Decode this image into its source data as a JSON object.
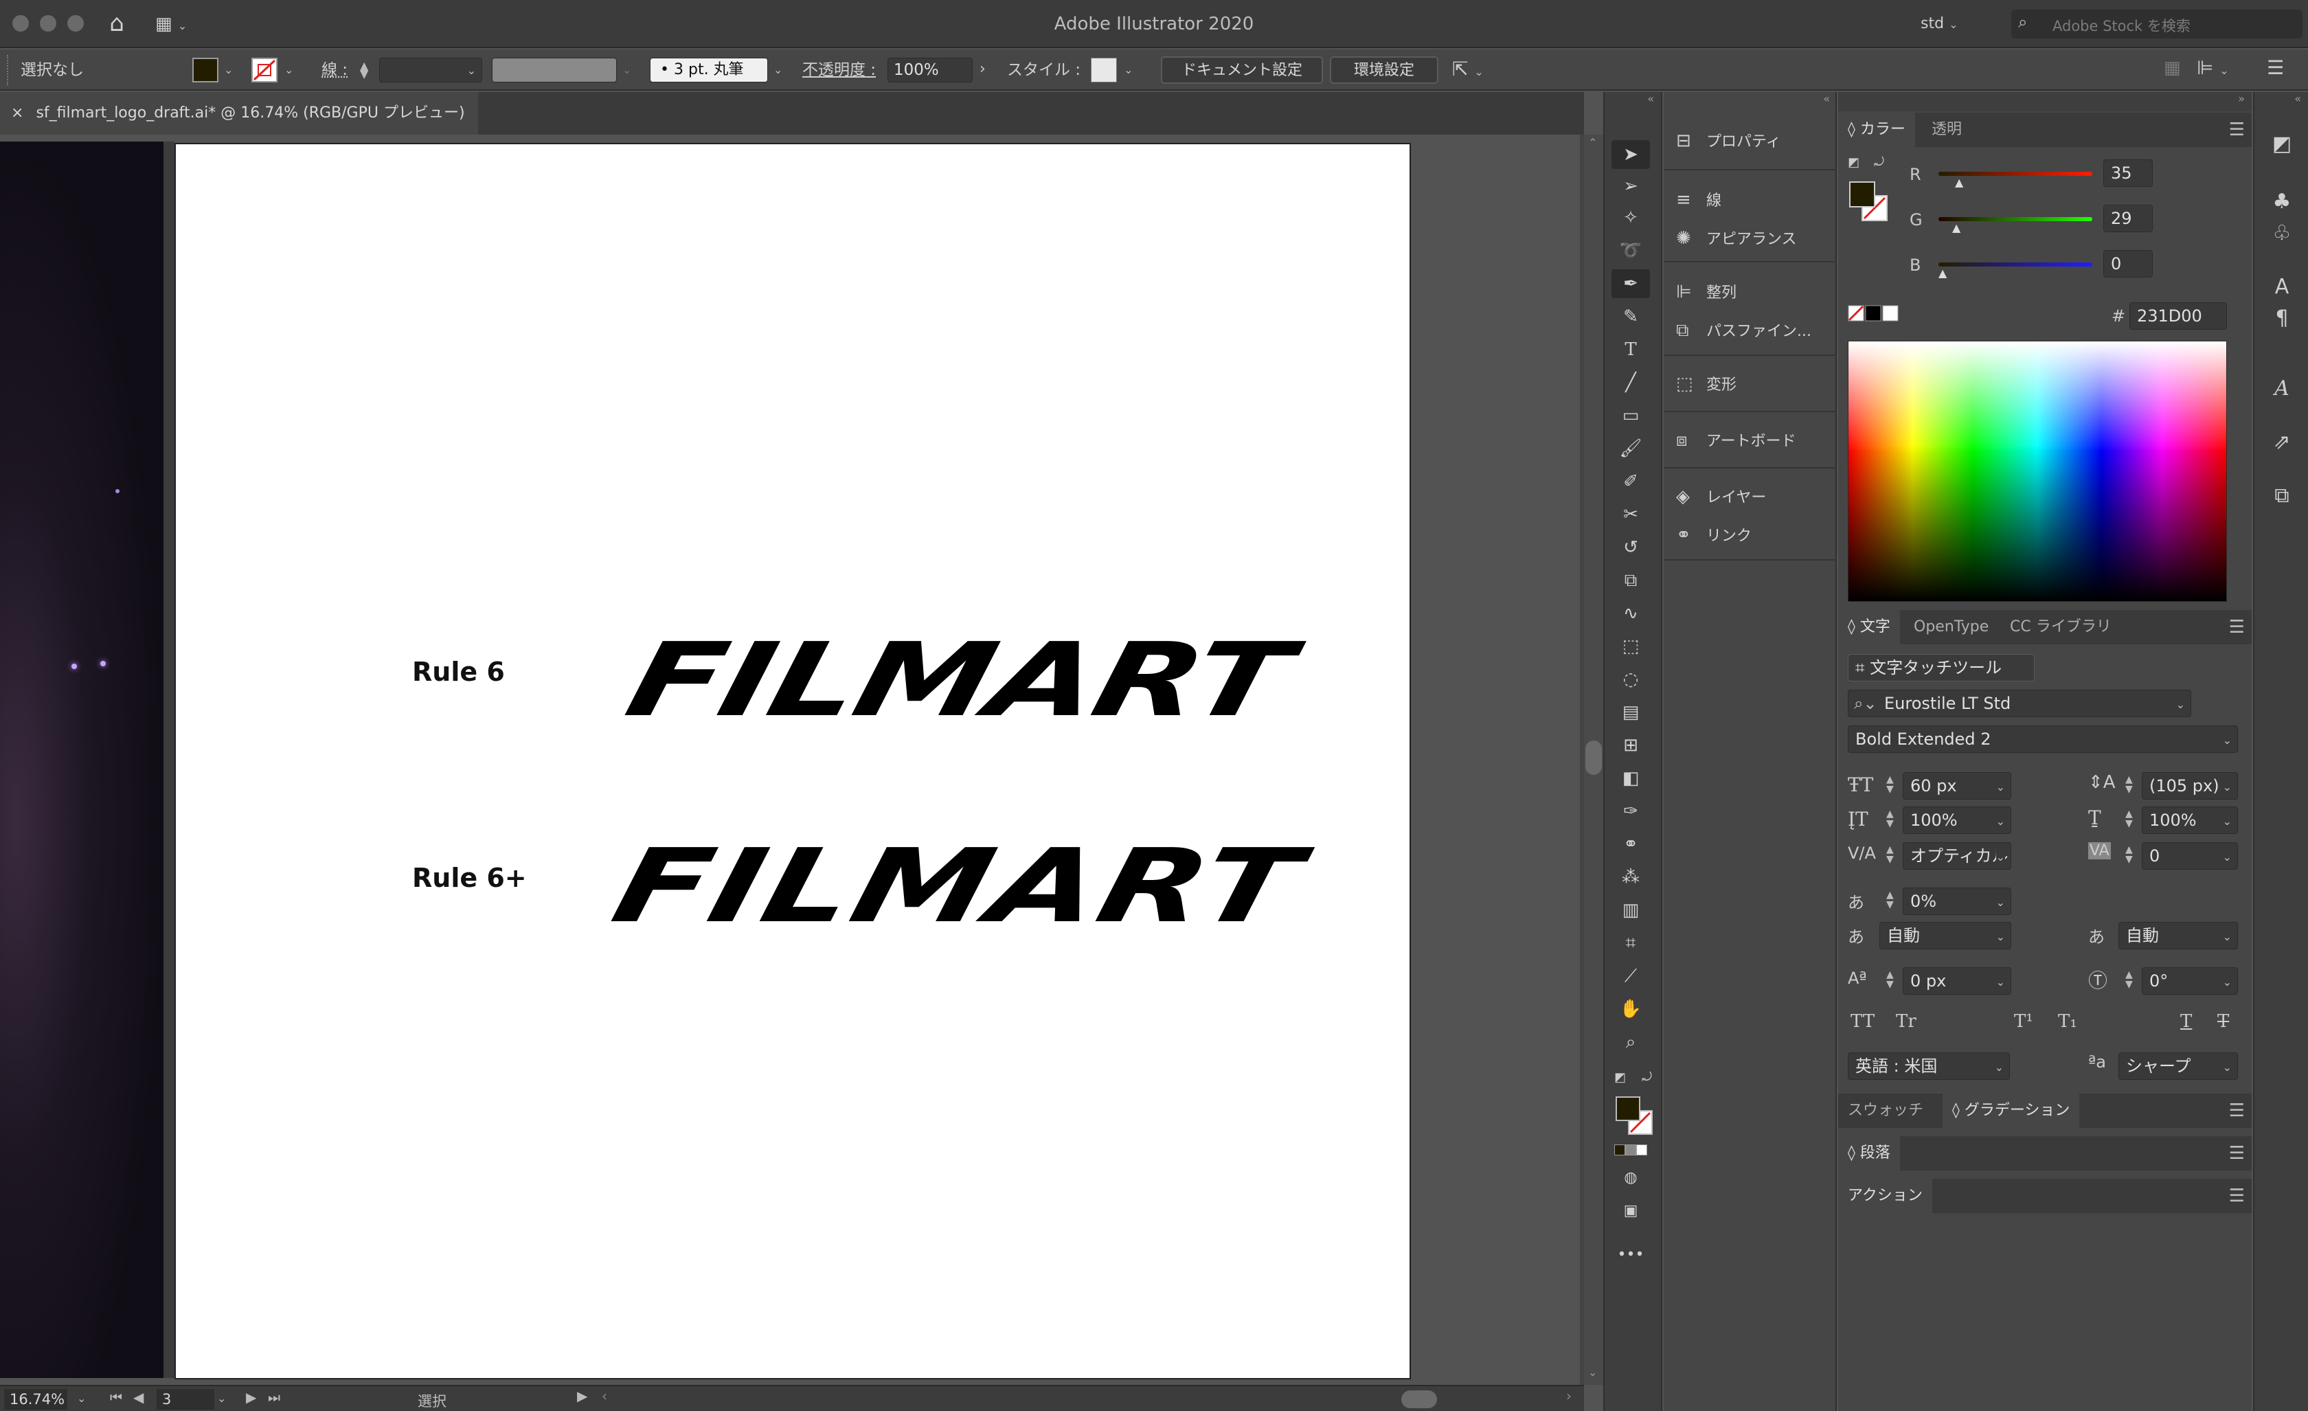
{
  "window": {
    "title": "Adobe Illustrator 2020",
    "workspace": "std",
    "stock_search_placeholder": "Adobe Stock を検索"
  },
  "controlbar": {
    "selection_status": "選択なし",
    "fill_color": "#231D00",
    "stroke_label": "線 :",
    "brush": "3 pt. 丸筆",
    "opacity_label": "不透明度 :",
    "opacity_value": "100%",
    "style_label": "スタイル :",
    "document_settings": "ドキュメント設定",
    "preferences": "環境設定"
  },
  "document_tab": {
    "title": "sf_filmart_logo_draft.ai* @ 16.74% (RGB/GPU プレビュー)"
  },
  "artboard": {
    "rows": [
      {
        "label": "Rule 6",
        "logo": "FILMART"
      },
      {
        "label": "Rule 6+",
        "logo": "FILMART"
      }
    ]
  },
  "statusbar": {
    "zoom": "16.74%",
    "artboard_number": "3",
    "status": "選択"
  },
  "dock": {
    "items": [
      {
        "label": "プロパティ",
        "icon": "properties-icon"
      },
      {
        "label": "線",
        "icon": "stroke-icon"
      },
      {
        "label": "アピアランス",
        "icon": "appearance-icon"
      },
      {
        "label": "整列",
        "icon": "align-icon"
      },
      {
        "label": "パスファイン...",
        "icon": "pathfinder-icon"
      },
      {
        "label": "変形",
        "icon": "transform-icon"
      },
      {
        "label": "アートボード",
        "icon": "artboard-icon"
      },
      {
        "label": "レイヤー",
        "icon": "layers-icon"
      },
      {
        "label": "リンク",
        "icon": "links-icon"
      }
    ]
  },
  "color_panel": {
    "tabs": [
      "カラー",
      "透明"
    ],
    "r_label": "R",
    "r_value": "35",
    "g_label": "G",
    "g_value": "29",
    "b_label": "B",
    "b_value": "0",
    "hex_label": "#",
    "hex_value": "231D00"
  },
  "character_panel": {
    "tabs": [
      "文字",
      "OpenType",
      "CC ライブラリ"
    ],
    "touch_type_tool": "文字タッチツール",
    "font_family": "Eurostile LT Std",
    "font_style": "Bold Extended 2",
    "font_size": "60 px",
    "leading": "(105 px)",
    "vertical_scale": "100%",
    "horizontal_scale": "100%",
    "kerning": "オプティカル",
    "tracking": "0",
    "tsume": "0%",
    "aki_left": "自動",
    "aki_right": "自動",
    "baseline_shift": "0 px",
    "rotation": "0°",
    "language": "英語 : 米国",
    "antialias": "シャープ",
    "caps_all": "TT",
    "caps_small": "Tr",
    "superscript": "T¹",
    "subscript": "T₁",
    "underline": "T",
    "strikethrough": "T"
  },
  "bottom_panels": {
    "swatches": "スウォッチ",
    "gradient": "グラデーション",
    "paragraph": "段落",
    "actions": "アクション"
  }
}
